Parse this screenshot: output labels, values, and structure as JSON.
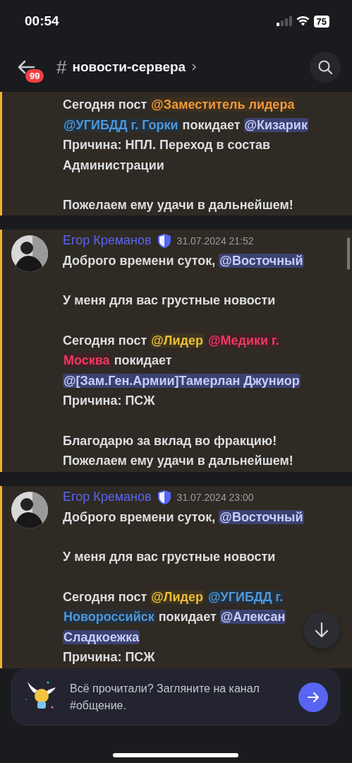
{
  "status_bar": {
    "time": "00:54",
    "battery": "75"
  },
  "header": {
    "unread_badge": "99",
    "hash": "#",
    "channel_title": "новости-сервера"
  },
  "messages": [
    {
      "highlighted": true,
      "paragraphs": [
        [
          [
            {
              "kind": "text",
              "text": "Сегодня пост "
            },
            {
              "kind": "role_mention",
              "text": "@Заместитель лидера",
              "color": "#3d2f1f"
            }
          ],
          [
            {
              "kind": "role_mention",
              "text": "@УГИБДД г. Горки",
              "color": "#25303a"
            },
            {
              "kind": "text",
              "text": " покидает "
            },
            {
              "kind": "user_mention",
              "text": "@Кизарик",
              "color": "#3c4270"
            }
          ],
          [
            {
              "kind": "text",
              "text": "Причина: НПЛ. Переход в состав"
            }
          ],
          [
            {
              "kind": "text",
              "text": "Администрации"
            }
          ]
        ],
        [
          [
            {
              "kind": "text",
              "text": "Пожелаем ему удачи в дальнейшем!"
            }
          ]
        ]
      ]
    },
    {
      "highlighted": true,
      "author": "Егор Креманов",
      "timestamp": "31.07.2024 21:52",
      "paragraphs": [
        [
          [
            {
              "kind": "text",
              "text": "Доброго времени суток, "
            },
            {
              "kind": "user_mention",
              "text": "@Восточный",
              "color": "#3c4270"
            }
          ]
        ],
        [
          [
            {
              "kind": "text",
              "text": "У меня для вас грустные новости"
            }
          ]
        ],
        [
          [
            {
              "kind": "text",
              "text": "Сегодня пост "
            },
            {
              "kind": "role_mention",
              "text": "@Лидер",
              "color": "#3d3520"
            },
            {
              "kind": "role_mention",
              "text": "@Медики г.",
              "color": "#3e2228"
            }
          ],
          [
            {
              "kind": "role_mention",
              "text": "Москва",
              "color": "#3e2228"
            },
            {
              "kind": "text",
              "text": " покидает"
            }
          ],
          [
            {
              "kind": "user_mention",
              "text": "@[Зам.Ген.Армии]Тамерлан Джуниор",
              "color": "#3c4270"
            }
          ],
          [
            {
              "kind": "text",
              "text": "Причина: ПСЖ"
            }
          ]
        ],
        [
          [
            {
              "kind": "text",
              "text": "Благодарю за вклад во фракцию!"
            }
          ],
          [
            {
              "kind": "text",
              "text": "Пожелаем ему удачи в дальнейшем!"
            }
          ]
        ]
      ]
    },
    {
      "highlighted": true,
      "author": "Егор Креманов",
      "timestamp": "31.07.2024 23:00",
      "paragraphs": [
        [
          [
            {
              "kind": "text",
              "text": "Доброго времени суток, "
            },
            {
              "kind": "user_mention",
              "text": "@Восточный",
              "color": "#3c4270"
            }
          ]
        ],
        [
          [
            {
              "kind": "text",
              "text": "У меня для вас грустные новости"
            }
          ]
        ],
        [
          [
            {
              "kind": "text",
              "text": "Сегодня пост "
            },
            {
              "kind": "role_mention",
              "text": "@Лидер",
              "color": "#3d3520"
            },
            {
              "kind": "role_mention",
              "text": "@УГИБДД г.",
              "color": "#25303a"
            }
          ],
          [
            {
              "kind": "role_mention",
              "text": "Новороссийск",
              "color": "#25303a"
            },
            {
              "kind": "text",
              "text": " покидает "
            },
            {
              "kind": "user_mention",
              "text": "@Алексан",
              "color": "#3c4270"
            }
          ],
          [
            {
              "kind": "user_mention",
              "text": "Сладкоежка",
              "color": "#3c4270"
            }
          ],
          [
            {
              "kind": "text",
              "text": "Причина: ПСЖ"
            }
          ]
        ]
      ]
    }
  ],
  "banner": {
    "text": "Всё прочитали? Загляните на канал #общение."
  }
}
